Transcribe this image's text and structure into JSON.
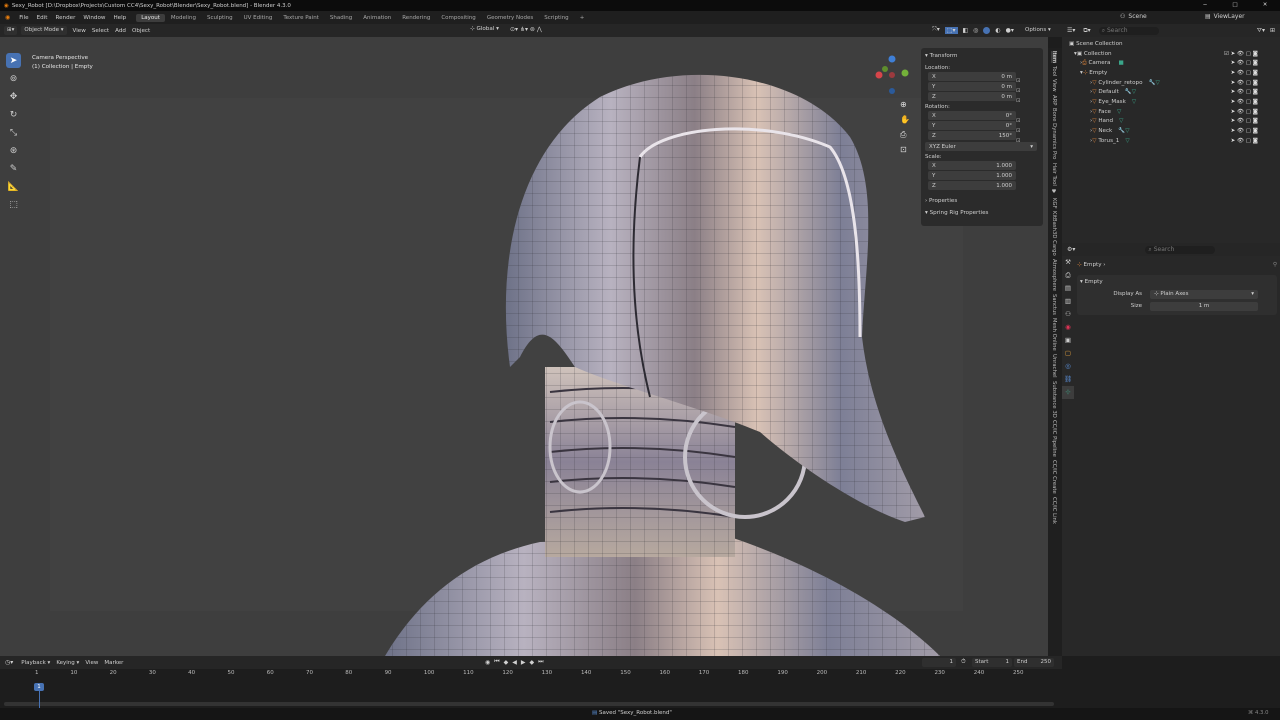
{
  "window": {
    "title": "Sexy_Robot [D:\\Dropbox\\Projects\\Custom CC4\\Sexy_Robot\\Blender\\Sexy_Robot.blend] - Blender 4.3.0",
    "min": "─",
    "max": "□",
    "close": "✕"
  },
  "menu": [
    "File",
    "Edit",
    "Render",
    "Window",
    "Help"
  ],
  "workspaces": [
    "Layout",
    "Modeling",
    "Sculpting",
    "UV Editing",
    "Texture Paint",
    "Shading",
    "Animation",
    "Rendering",
    "Compositing",
    "Geometry Nodes",
    "Scripting"
  ],
  "active_workspace": "Layout",
  "scene": {
    "label": "Scene",
    "viewlayer": "ViewLayer"
  },
  "viewport_header": {
    "mode": "Object Mode",
    "items": [
      "View",
      "Select",
      "Add",
      "Object"
    ],
    "orientation": "Global",
    "options": "Options"
  },
  "overlay_text": {
    "line1": "Camera Perspective",
    "line2": "(1) Collection | Empty"
  },
  "npanel": {
    "transform": "Transform",
    "location_label": "Location:",
    "location": [
      {
        "axis": "X",
        "value": "0 m"
      },
      {
        "axis": "Y",
        "value": "0 m"
      },
      {
        "axis": "Z",
        "value": "0 m"
      }
    ],
    "rotation_label": "Rotation:",
    "rotation": [
      {
        "axis": "X",
        "value": "0°"
      },
      {
        "axis": "Y",
        "value": "0°"
      },
      {
        "axis": "Z",
        "value": "150°"
      }
    ],
    "rotation_mode": "XYZ Euler",
    "scale_label": "Scale:",
    "scale": [
      {
        "axis": "X",
        "value": "1.000"
      },
      {
        "axis": "Y",
        "value": "1.000"
      },
      {
        "axis": "Z",
        "value": "1.000"
      }
    ],
    "properties": "Properties",
    "spring": "Spring Rig Properties"
  },
  "vertical_tabs": [
    "Item",
    "Tool",
    "View",
    "ARP",
    "Bone Dynamics Pro",
    "Hair Tool",
    "",
    "KGF",
    "KitBash3D Cargo",
    "Atmosphere",
    "Sanctus",
    "Mesh Online",
    "Unrachel",
    "Substance 3D",
    "CC/IC Pipeline",
    "CC/IC Create",
    "CC/IC Link"
  ],
  "outliner": {
    "search_placeholder": "Search",
    "items": [
      {
        "name": "Scene Collection",
        "indent": 0
      },
      {
        "name": "Collection",
        "indent": 1
      },
      {
        "name": "Camera",
        "indent": 2
      },
      {
        "name": "Empty",
        "indent": 2
      },
      {
        "name": "Cylinder_retopo",
        "indent": 3
      },
      {
        "name": "Default",
        "indent": 3
      },
      {
        "name": "Eye_Mask",
        "indent": 3
      },
      {
        "name": "Face",
        "indent": 3
      },
      {
        "name": "Hand",
        "indent": 3
      },
      {
        "name": "Neck",
        "indent": 3
      },
      {
        "name": "Torus_1",
        "indent": 3
      }
    ]
  },
  "properties": {
    "search_placeholder": "Search",
    "object": "Empty",
    "section": "Empty",
    "display_as_label": "Display As",
    "display_as": "Plain Axes",
    "size_label": "Size",
    "size": "1 m"
  },
  "timeline": {
    "menus": [
      "Playback",
      "Keying",
      "View",
      "Marker"
    ],
    "current_frame": "1",
    "start_label": "Start",
    "start": "1",
    "end_label": "End",
    "end": "250",
    "ticks": [
      "1",
      "10",
      "20",
      "30",
      "40",
      "50",
      "60",
      "70",
      "80",
      "90",
      "100",
      "110",
      "120",
      "130",
      "140",
      "150",
      "160",
      "170",
      "180",
      "190",
      "200",
      "210",
      "220",
      "230",
      "240",
      "250"
    ]
  },
  "status": {
    "message": "Saved \"Sexy_Robot.blend\"",
    "version": "4.3.0"
  },
  "colors": {
    "accent": "#4772b3",
    "header": "#262626",
    "panel": "#2b2b2b"
  }
}
